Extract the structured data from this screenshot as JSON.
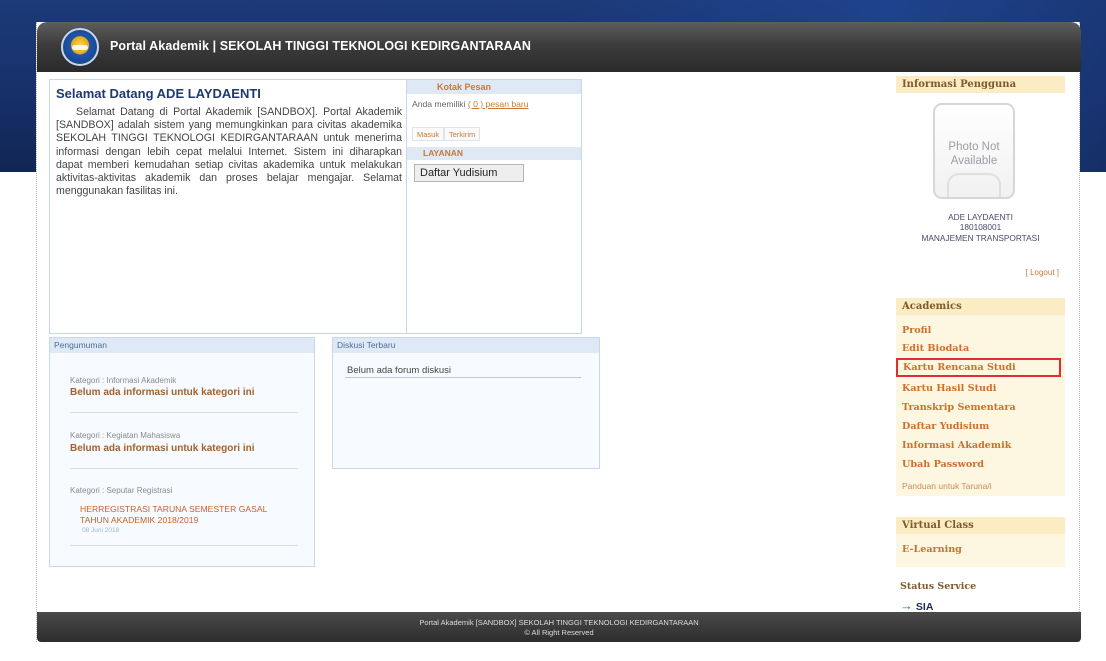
{
  "header": {
    "title": "Portal Akademik | SEKOLAH TINGGI TEKNOLOGI KEDIRGANTARAAN",
    "logo_icon": "institution-emblem-icon"
  },
  "welcome": {
    "heading": "Selamat Datang ADE LAYDAENTI",
    "text": "Selamat Datang di Portal Akademik [SANDBOX]. Portal Akademik [SANDBOX] adalah sistem yang memungkinkan para civitas akademika SEKOLAH TINGGI TEKNOLOGI KEDIRGANTARAAN untuk menerima informasi dengan lebih cepat melalui Internet. Sistem ini diharapkan dapat memberi kemudahan setiap civitas akademika untuk melakukan aktivitas-aktivitas akademik dan proses belajar mengajar. Selamat menggunakan fasilitas ini."
  },
  "kotak_pesan": {
    "title": "Kotak Pesan",
    "info_prefix": "Anda memiliki",
    "info_link": "( 0 ) pesan baru",
    "tab_masuk": "Masuk",
    "tab_terkirim": "Terkirim"
  },
  "layanan": {
    "title": "LAYANAN",
    "button": "Daftar Yudisium"
  },
  "pengumuman": {
    "title": "Pengumuman",
    "cat1_label": "Kategori : Informasi Akademik",
    "cat1_item": "Belum ada informasi untuk kategori ini",
    "cat2_label": "Kategori : Kegiatan Mahasiswa",
    "cat2_item": "Belum ada informasi untuk kategori ini",
    "cat3_label": "Kategori : Seputar Registrasi",
    "cat3_item": "HERREGISTRASI TARUNA SEMESTER GASAL TAHUN AKADEMIK 2018/2019",
    "cat3_date": "08 Juni 2018"
  },
  "diskusi": {
    "title": "Diskusi Terbaru",
    "empty": "Belum ada forum diskusi"
  },
  "user_info": {
    "title": "Informasi Pengguna",
    "photo_text": "Photo Not Available",
    "name": "ADE LAYDAENTI",
    "nim": "180108001",
    "program": "MANAJEMEN TRANSPORTASI",
    "logout": "[ Logout ]"
  },
  "academics": {
    "title": "Academics",
    "items": [
      "Profil",
      "Edit Biodata",
      "Kartu Rencana Studi",
      "Kartu Hasil Studi",
      "Transkrip Sementara",
      "Daftar Yudisium",
      "Informasi Akademik",
      "Ubah Password"
    ],
    "panduan": "Panduan untuk Taruna/i"
  },
  "virtual_class": {
    "title": "Virtual Class",
    "item": "E-Learning"
  },
  "status": {
    "title": "Status Service",
    "item": "SIA"
  },
  "footer": {
    "line1": "Portal Akademik [SANDBOX] SEKOLAH TINGGI TEKNOLOGI KEDIRGANTARAAN",
    "line2": "© All Right Reserved"
  },
  "colors": {
    "highlight_border": "#e32c2c",
    "link_orange": "#cf6f2c"
  }
}
